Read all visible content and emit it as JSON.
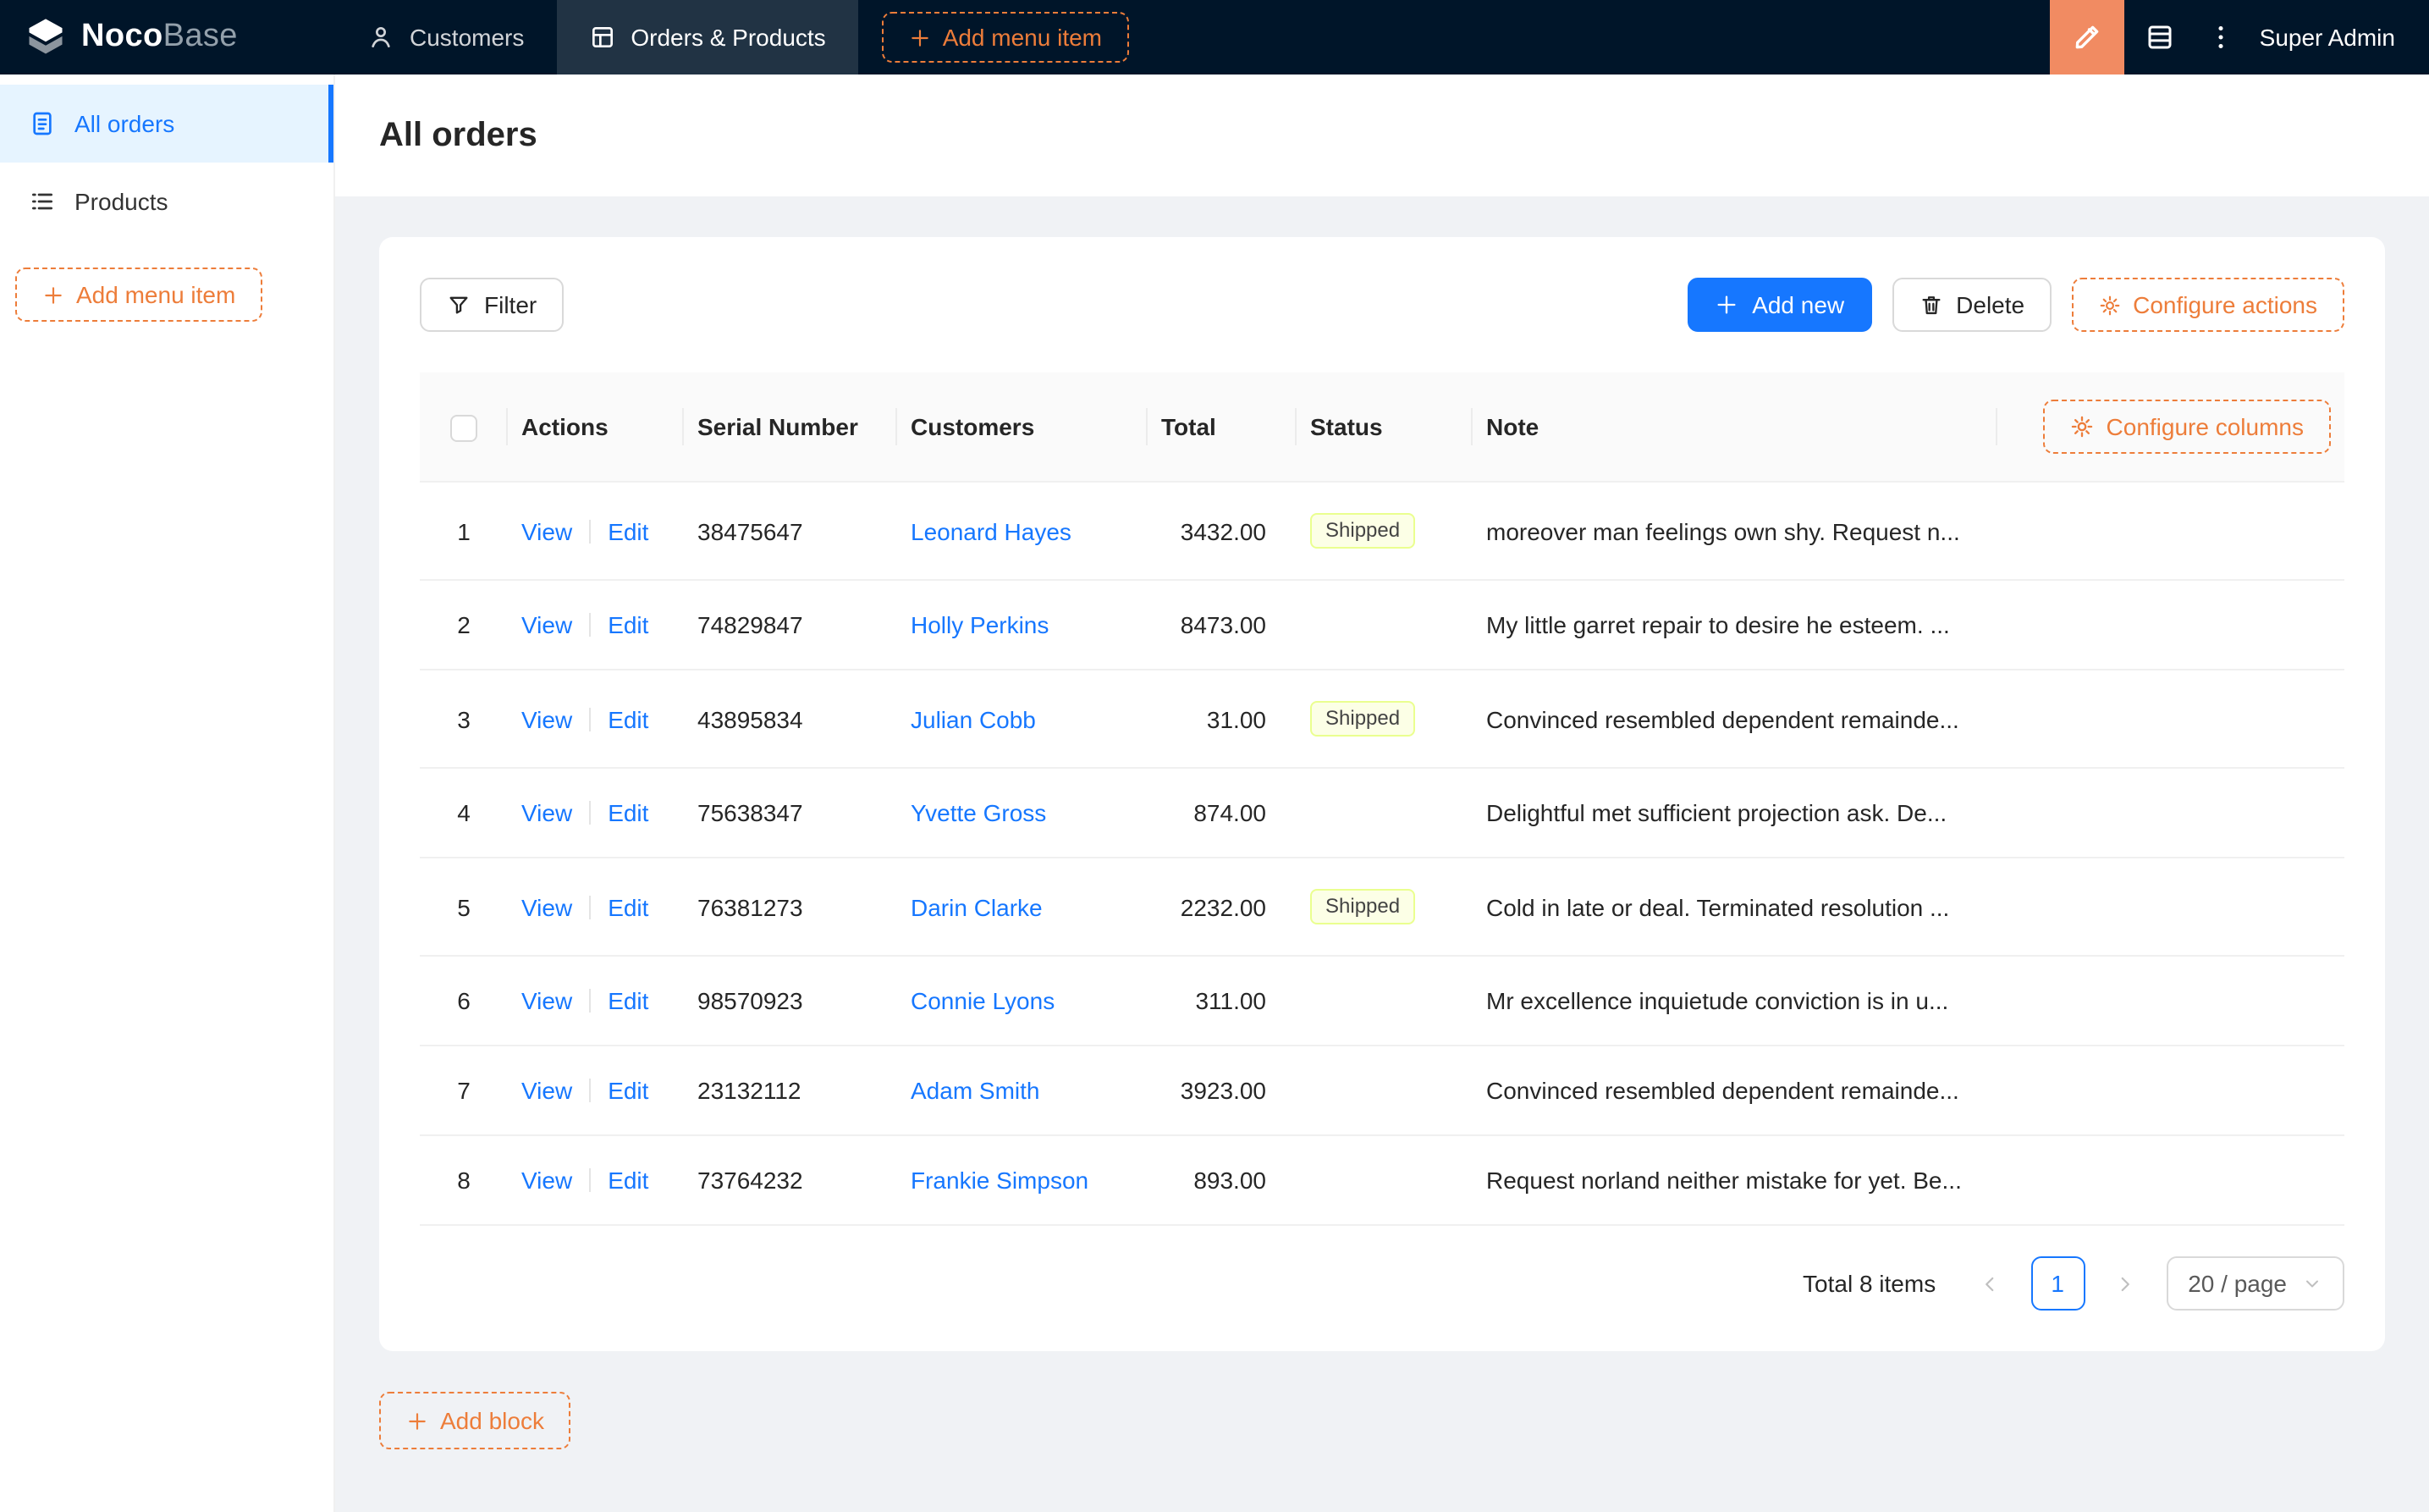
{
  "colors": {
    "topbar_bg": "#001529",
    "primary_blue": "#1677ff",
    "accent_orange": "#ed7d3a",
    "designer_button_orange": "#f18b62",
    "sidebar_active_bg": "#e6f4ff",
    "status_shipped_bg": "#fcffe6",
    "status_shipped_border": "#eaff8f"
  },
  "topbar": {
    "logo_primary": "Noco",
    "logo_secondary": "Base",
    "menu": [
      {
        "label": "Customers"
      },
      {
        "label": "Orders & Products"
      }
    ],
    "add_menu_item_label": "Add menu item",
    "user_name": "Super Admin"
  },
  "sidebar": {
    "items": [
      {
        "label": "All orders"
      },
      {
        "label": "Products"
      }
    ],
    "add_menu_item_label": "Add menu item"
  },
  "page": {
    "title": "All orders"
  },
  "toolbar": {
    "filter_label": "Filter",
    "add_new_label": "Add new",
    "delete_label": "Delete",
    "configure_actions_label": "Configure actions"
  },
  "table": {
    "headers": [
      "Actions",
      "Serial Number",
      "Customers",
      "Total",
      "Status",
      "Note"
    ],
    "configure_columns_label": "Configure columns",
    "view_label": "View",
    "edit_label": "Edit",
    "rows": [
      {
        "index": "1",
        "serial": "38475647",
        "customer": "Leonard Hayes",
        "total": "3432.00",
        "status": "Shipped",
        "note": "moreover man feelings own shy. Request n..."
      },
      {
        "index": "2",
        "serial": "74829847",
        "customer": "Holly Perkins",
        "total": "8473.00",
        "status": "",
        "note": "My little garret repair to desire he esteem. ..."
      },
      {
        "index": "3",
        "serial": "43895834",
        "customer": "Julian Cobb",
        "total": "31.00",
        "status": "Shipped",
        "note": "Convinced resembled dependent remainde..."
      },
      {
        "index": "4",
        "serial": "75638347",
        "customer": "Yvette Gross",
        "total": "874.00",
        "status": "",
        "note": "Delightful met sufficient projection ask. De..."
      },
      {
        "index": "5",
        "serial": "76381273",
        "customer": "Darin Clarke",
        "total": "2232.00",
        "status": "Shipped",
        "note": "Cold in late or deal. Terminated resolution ..."
      },
      {
        "index": "6",
        "serial": "98570923",
        "customer": "Connie Lyons",
        "total": "311.00",
        "status": "",
        "note": "Mr excellence inquietude conviction is in u..."
      },
      {
        "index": "7",
        "serial": "23132112",
        "customer": "Adam Smith",
        "total": "3923.00",
        "status": "",
        "note": "Convinced resembled dependent remainde..."
      },
      {
        "index": "8",
        "serial": "73764232",
        "customer": "Frankie Simpson",
        "total": "893.00",
        "status": "",
        "note": "Request norland neither mistake for yet. Be..."
      }
    ]
  },
  "pagination": {
    "total_label": "Total 8 items",
    "current_page": "1",
    "page_size_label": "20 / page"
  },
  "footer": {
    "add_block_label": "Add block"
  }
}
